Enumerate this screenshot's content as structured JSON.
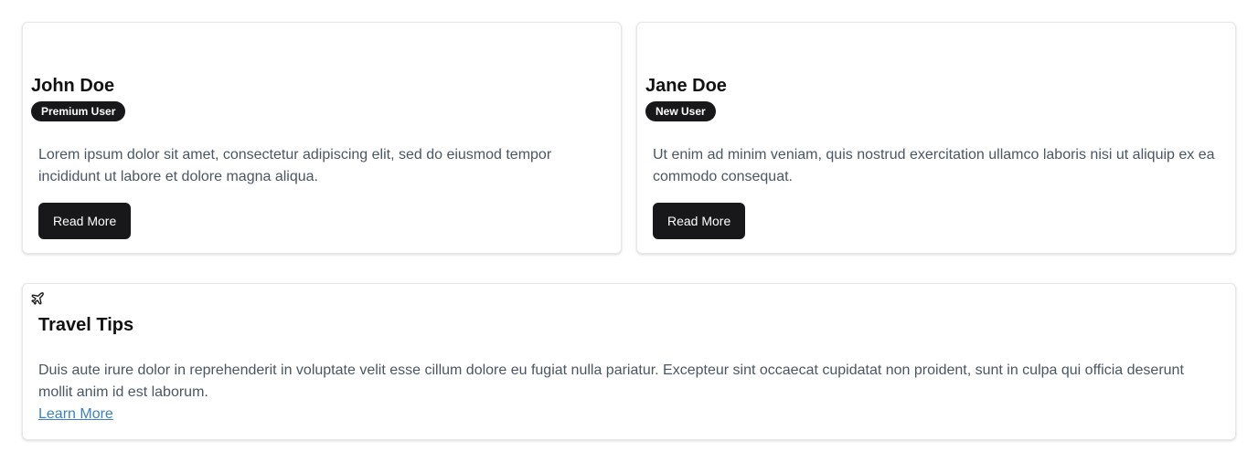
{
  "cards": [
    {
      "name": "John Doe",
      "badge": "Premium User",
      "text": "Lorem ipsum dolor sit amet, consectetur adipiscing elit, sed do eiusmod tempor incididunt ut labore et dolore magna aliqua.",
      "button_label": "Read More"
    },
    {
      "name": "Jane Doe",
      "badge": "New User",
      "text": "Ut enim ad minim veniam, quis nostrud exercitation ullamco laboris nisi ut aliquip ex ea commodo consequat.",
      "button_label": "Read More"
    }
  ],
  "travel": {
    "icon": "plane-icon",
    "title": "Travel Tips",
    "text": "Duis aute irure dolor in reprehenderit in voluptate velit esse cillum dolore eu fugiat nulla pariatur. Excepteur sint occaecat cupidatat non proident, sunt in culpa qui officia deserunt mollit anim id est laborum.",
    "link_label": "Learn More"
  },
  "colors": {
    "button_bg": "#18181b",
    "badge_bg": "#18181b",
    "body_text": "#4b5563",
    "link": "#3b82c4"
  }
}
